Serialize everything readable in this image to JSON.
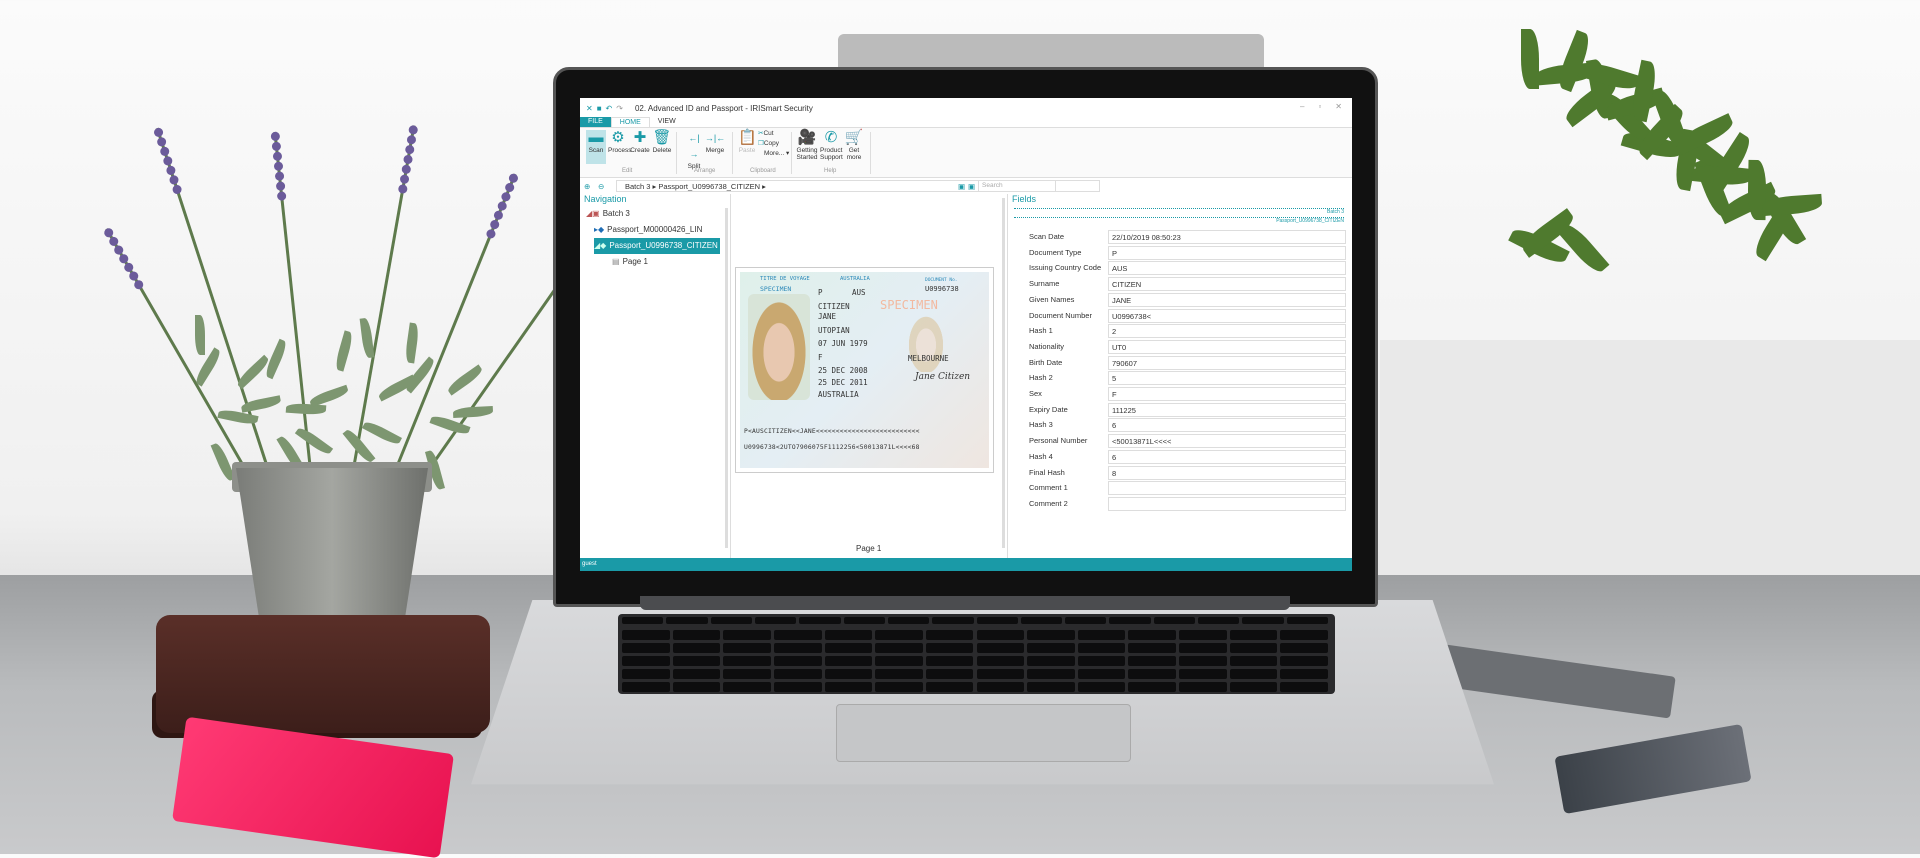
{
  "app": {
    "title": "02. Advanced ID and Passport - IRISmart Security",
    "tabs": [
      {
        "label": "FILE"
      },
      {
        "label": "HOME"
      },
      {
        "label": "VIEW"
      }
    ],
    "ribbon": {
      "buttons": [
        {
          "label": "Scan",
          "icon": "folder-scan-icon"
        },
        {
          "label": "Process",
          "icon": "gears-icon"
        },
        {
          "label": "Create",
          "icon": "plus-icon"
        },
        {
          "label": "Delete",
          "icon": "trash-icon"
        },
        {
          "label": "Split",
          "icon": "split-icon"
        },
        {
          "label": "Merge",
          "icon": "merge-icon"
        },
        {
          "label": "Paste",
          "icon": "paste-icon"
        },
        {
          "label": "Cut",
          "icon": "scissors-icon"
        },
        {
          "label": "Copy",
          "icon": "copy-icon"
        },
        {
          "label": "More...",
          "icon": "more-icon"
        },
        {
          "label": "Getting Started",
          "icon": "video-icon"
        },
        {
          "label": "Product Support",
          "icon": "support-icon"
        },
        {
          "label": "Get more",
          "icon": "cart-icon"
        }
      ],
      "groups": [
        "Edit",
        "Arrange",
        "Clipboard",
        "Help"
      ]
    },
    "breadcrumb": [
      "Batch 3",
      "Passport_U0996738_CITIZEN"
    ],
    "search_placeholder": "Search",
    "navigation": {
      "title": "Navigation",
      "items": [
        {
          "label": "Batch 3",
          "icon": "batch-icon"
        },
        {
          "label": "Passport_M00000426_LIN",
          "icon": "passport-icon"
        },
        {
          "label": "Passport_U0996738_CITIZEN",
          "icon": "passport-icon",
          "selected": true
        },
        {
          "label": "Page 1",
          "icon": "page-icon"
        }
      ]
    },
    "viewer": {
      "page_label": "Page 1",
      "passport": {
        "header_left": "TITRE DE VOYAGE",
        "specimen": "SPECIMEN",
        "country": "AUSTRALIA",
        "doc_no_label": "DOCUMENT No.",
        "doc_no": "U0996738",
        "type": "P",
        "code": "AUS",
        "surname": "CITIZEN",
        "given": "JANE",
        "nationality": "UTOPIAN",
        "dob": "07 JUN 1979",
        "sex": "F",
        "issue": "25 DEC 2008",
        "expiry": "25 DEC 2011",
        "authority": "AUSTRALIA",
        "place_of_birth": "MELBOURNE",
        "signature": "Jane Citizen",
        "mrz1": "P<AUSCITIZEN<<JANE<<<<<<<<<<<<<<<<<<<<<<<<<<",
        "mrz2": "U0996738<2UTO7906075F1112256<50013871L<<<<68"
      }
    },
    "fields": {
      "title": "Fields",
      "batch_link": "Batch 3",
      "doc_link": "Passport_U0996738_CITIZEN",
      "rows": [
        {
          "label": "Scan Date",
          "value": "22/10/2019 08:50:23"
        },
        {
          "label": "Document Type",
          "value": "P"
        },
        {
          "label": "Issuing Country Code",
          "value": "AUS"
        },
        {
          "label": "Surname",
          "value": "CITIZEN"
        },
        {
          "label": "Given Names",
          "value": "JANE"
        },
        {
          "label": "Document Number",
          "value": "U0996738<"
        },
        {
          "label": "Hash 1",
          "value": "2"
        },
        {
          "label": "Nationality",
          "value": "UT0"
        },
        {
          "label": "Birth Date",
          "value": "790607"
        },
        {
          "label": "Hash 2",
          "value": "5"
        },
        {
          "label": "Sex",
          "value": "F"
        },
        {
          "label": "Expiry Date",
          "value": "111225"
        },
        {
          "label": "Hash 3",
          "value": "6"
        },
        {
          "label": "Personal Number",
          "value": "<50013871L<<<<"
        },
        {
          "label": "Hash 4",
          "value": "6"
        },
        {
          "label": "Final Hash",
          "value": "8"
        },
        {
          "label": "Comment 1",
          "value": ""
        },
        {
          "label": "Comment 2",
          "value": ""
        }
      ]
    },
    "status_user": "guest",
    "accent_color": "#1a9aa7"
  }
}
